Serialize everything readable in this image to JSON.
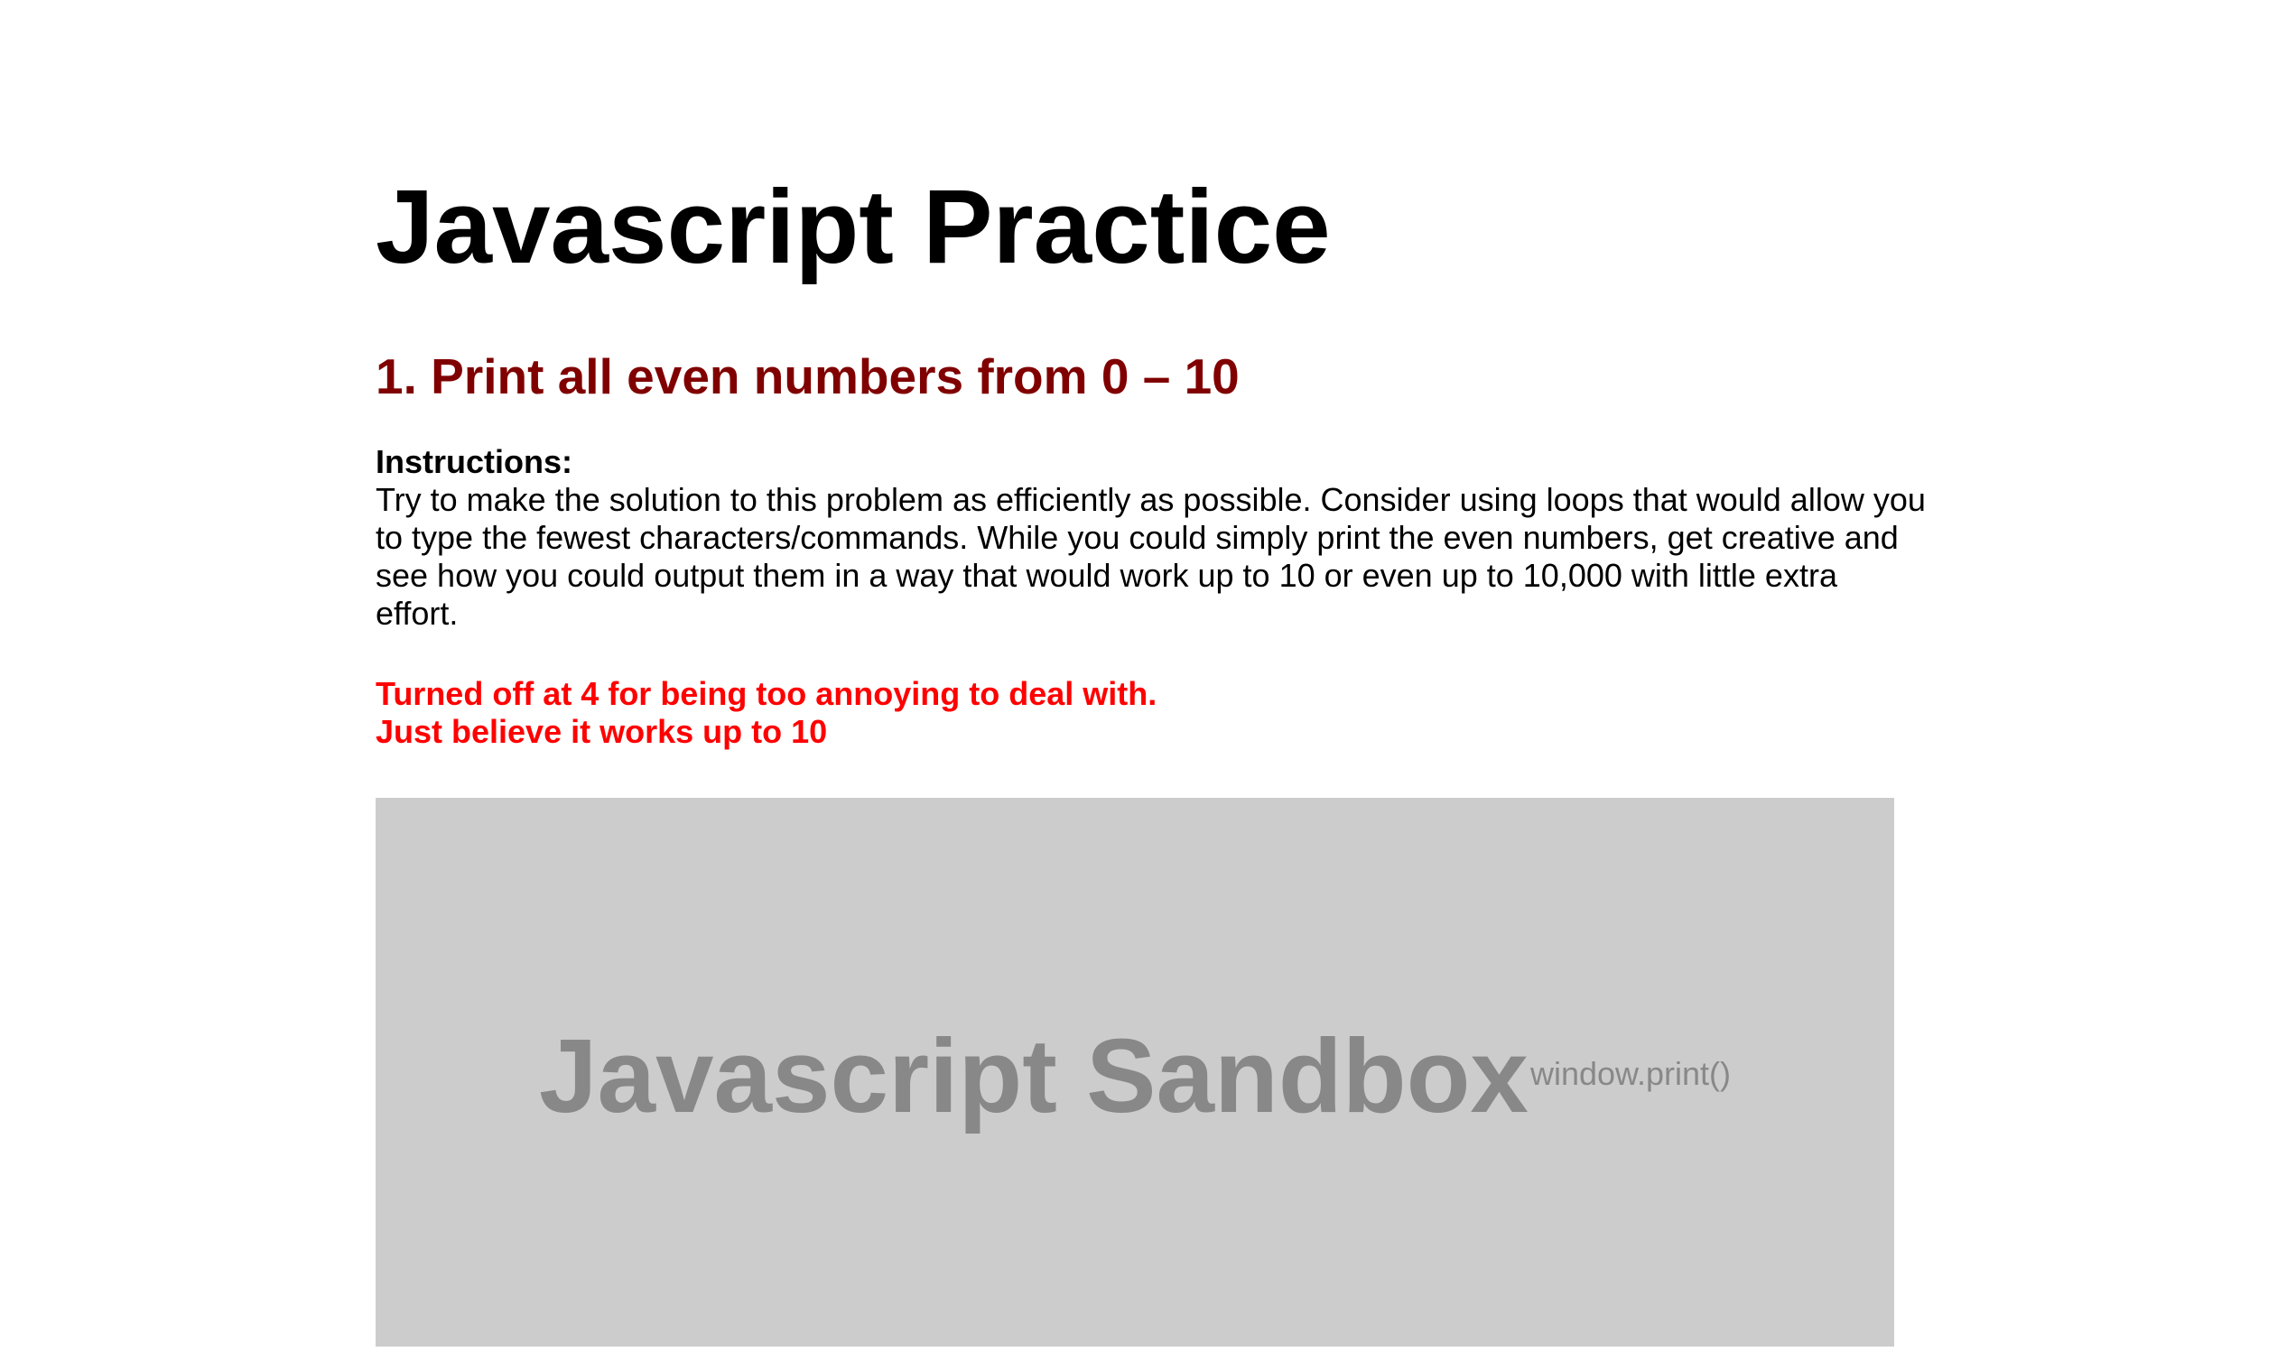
{
  "page": {
    "title": "Javascript Practice"
  },
  "problem": {
    "heading": "1. Print all even numbers from 0 – 10",
    "instructions_label": "Instructions:",
    "instructions_text": "Try to make the solution to this problem as efficiently as possible. Consider using loops that would allow you to type the fewest characters/commands. While you could simply print the even numbers, get creative and see how you could output them in a way that would work up to 10 or even up to 10,000 with little extra effort.",
    "note_lines": [
      "Turned off at 4 for being too annoying to deal with.",
      "Just believe it works up to 10"
    ]
  },
  "sandbox": {
    "title": "Javascript Sandbox",
    "subtitle": "window.print()"
  },
  "colors": {
    "heading": "#800000",
    "note": "#ff0000",
    "sandbox_bg": "#cccccc",
    "sandbox_text": "#888888"
  }
}
